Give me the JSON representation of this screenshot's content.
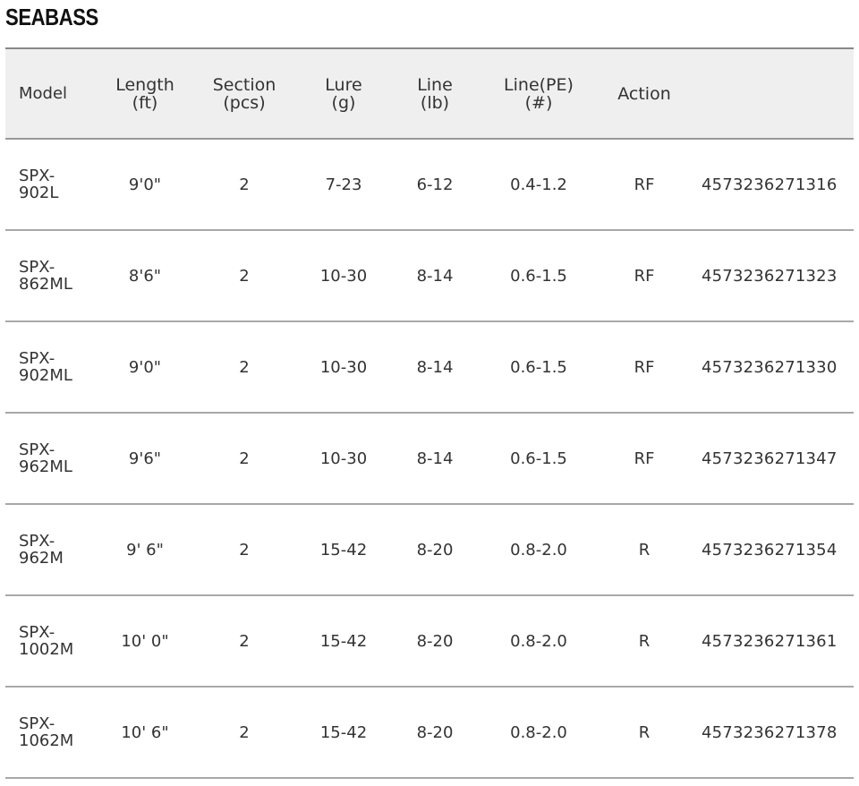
{
  "page_title": "SEABASS",
  "columns": [
    {
      "label": "Model",
      "unit": ""
    },
    {
      "label": "Length",
      "unit": "(ft)"
    },
    {
      "label": "Section",
      "unit": "(pcs)"
    },
    {
      "label": "Lure",
      "unit": "(g)"
    },
    {
      "label": "Line",
      "unit": "(lb)"
    },
    {
      "label": "Line(PE)",
      "unit": "(#)"
    },
    {
      "label": "Action",
      "unit": ""
    },
    {
      "label": "",
      "unit": ""
    }
  ],
  "rows": [
    {
      "model_prefix": "SPX-",
      "model_code": "902L",
      "length": "9'0\"",
      "section": "2",
      "lure": "7-23",
      "line": "6-12",
      "line_pe": "0.4-1.2",
      "action": "RF",
      "jan": "4573236271316"
    },
    {
      "model_prefix": "SPX-",
      "model_code": "862ML",
      "length": "8'6\"",
      "section": "2",
      "lure": "10-30",
      "line": "8-14",
      "line_pe": "0.6-1.5",
      "action": "RF",
      "jan": "4573236271323"
    },
    {
      "model_prefix": "SPX-",
      "model_code": "902ML",
      "length": "9'0\"",
      "section": "2",
      "lure": "10-30",
      "line": "8-14",
      "line_pe": "0.6-1.5",
      "action": "RF",
      "jan": "4573236271330"
    },
    {
      "model_prefix": "SPX-",
      "model_code": "962ML",
      "length": "9'6\"",
      "section": "2",
      "lure": "10-30",
      "line": "8-14",
      "line_pe": "0.6-1.5",
      "action": "RF",
      "jan": "4573236271347"
    },
    {
      "model_prefix": "SPX-",
      "model_code": "962M",
      "length": "9' 6\"",
      "section": "2",
      "lure": "15-42",
      "line": "8-20",
      "line_pe": "0.8-2.0",
      "action": "R",
      "jan": "4573236271354"
    },
    {
      "model_prefix": "SPX-",
      "model_code": "1002M",
      "length": "10' 0\"",
      "section": "2",
      "lure": "15-42",
      "line": "8-20",
      "line_pe": "0.8-2.0",
      "action": "R",
      "jan": "4573236271361"
    },
    {
      "model_prefix": "SPX-",
      "model_code": "1062M",
      "length": "10' 6\"",
      "section": "2",
      "lure": "15-42",
      "line": "8-20",
      "line_pe": "0.8-2.0",
      "action": "R",
      "jan": "4573236271378"
    }
  ]
}
